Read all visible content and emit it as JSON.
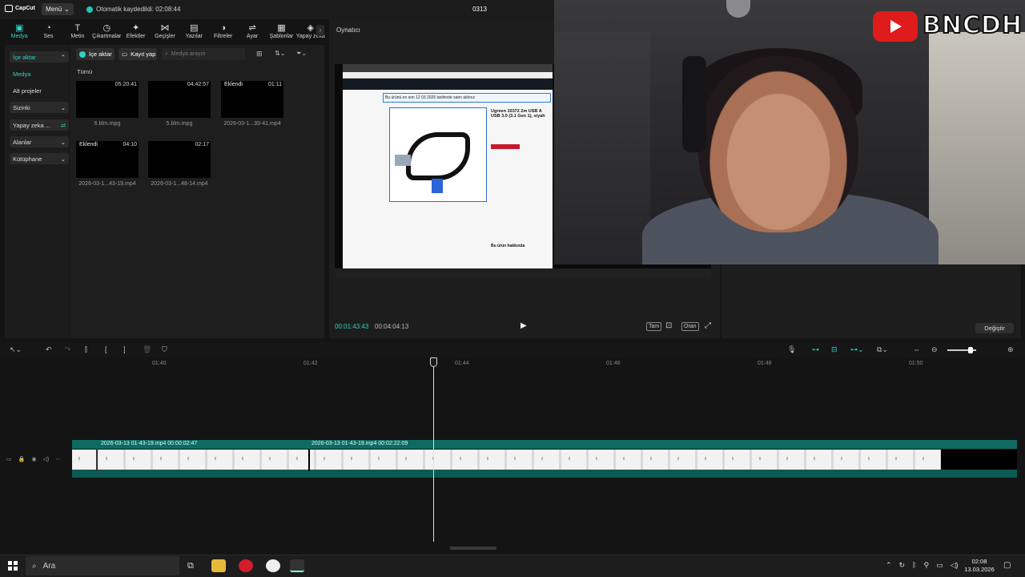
{
  "titlebar": {
    "app_name": "CapCut",
    "menu_label": "Menü",
    "autosave_text": "Otomatik kaydedildi: 02:08:44",
    "project_title": "0313"
  },
  "tools": [
    {
      "label": "Medya",
      "icon": "media-icon",
      "glyph": "▣",
      "active": true
    },
    {
      "label": "Ses",
      "icon": "audio-icon",
      "glyph": "◔"
    },
    {
      "label": "Metin",
      "icon": "text-icon",
      "glyph": "T"
    },
    {
      "label": "Çıkartmalar",
      "icon": "sticker-icon",
      "glyph": "◷"
    },
    {
      "label": "Efektler",
      "icon": "effects-icon",
      "glyph": "✦"
    },
    {
      "label": "Geçişler",
      "icon": "transitions-icon",
      "glyph": "⋈"
    },
    {
      "label": "Yazılar",
      "icon": "captions-icon",
      "glyph": "▤"
    },
    {
      "label": "Filtreler",
      "icon": "filters-icon",
      "glyph": "◑"
    },
    {
      "label": "Ayar",
      "icon": "adjust-icon",
      "glyph": "⇌"
    },
    {
      "label": "Şablonlar",
      "icon": "templates-icon",
      "glyph": "▦"
    },
    {
      "label": "Yapay zekâ",
      "icon": "ai-icon",
      "glyph": "◈"
    }
  ],
  "sidebar": {
    "items": [
      {
        "label": "İçe aktar",
        "suffix": "⌃"
      },
      {
        "label": "Medya",
        "suffix": ""
      },
      {
        "label": "Alt projeler",
        "suffix": ""
      },
      {
        "label": "Sizinki",
        "suffix": "⌄"
      },
      {
        "label": "Yapay zeka ...",
        "suffix": "⇌"
      },
      {
        "label": "Alanlar",
        "suffix": "⌄"
      },
      {
        "label": "Kütüphane",
        "suffix": "⌄"
      }
    ]
  },
  "media": {
    "import_label": "İçe aktar",
    "record_label": "Kayıt yap",
    "search_placeholder": "Medya arayın",
    "all_label": "Tümü",
    "clips": [
      {
        "name": "6.blm.mpg",
        "duration": "05:20:41",
        "tag": ""
      },
      {
        "name": "5.blm.mpg",
        "duration": "04:42:57",
        "tag": ""
      },
      {
        "name": "2026-03-1...39-41.mp4",
        "duration": "01:11",
        "tag": "Eklendi"
      },
      {
        "name": "2026-03-1...43-19.mp4",
        "duration": "04:10",
        "tag": "Eklendi"
      },
      {
        "name": "2026-03-1...48-14.mp4",
        "duration": "02:17",
        "tag": ""
      }
    ]
  },
  "player": {
    "title": "Oynatıcı",
    "current_time": "00:01:43:43",
    "total_time": "00:04:04:13",
    "full_label": "Tam",
    "ratio_label": "Oran",
    "page_tags": [
      "Bu ürünü en son 12 03 2026 tarihinde satın aldınız",
      "Ugreen 10372 2m USB A USB 3.0 (3.1 Gen 1), siyah",
      "Bu ürün hakkında"
    ]
  },
  "details": {
    "change_label": "Değiştir"
  },
  "webcam": {
    "brand": "BNCDH"
  },
  "timeline": {
    "ticks": [
      {
        "label": "01:40"
      },
      {
        "label": "01:42"
      },
      {
        "label": "01:44"
      },
      {
        "label": "01:46"
      },
      {
        "label": "01:48"
      },
      {
        "label": "01:50"
      }
    ],
    "clip1": "2026-03-13 01-43-19.mp4  00:00:02:47",
    "clip2": "2026-03-13 01-43-19.mp4  00:02:22:09"
  },
  "taskbar": {
    "search_label": "Ara",
    "time": "02:08",
    "date": "13.03.2026"
  }
}
